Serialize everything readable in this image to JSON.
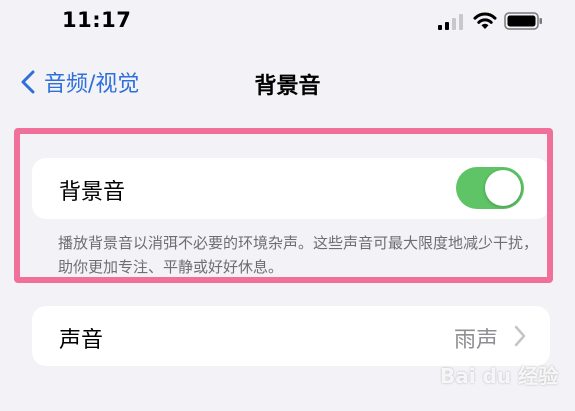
{
  "status_bar": {
    "time": "11:17",
    "signal_icon": "cellular-signal-icon",
    "wifi_icon": "wifi-icon",
    "battery_icon": "battery-icon"
  },
  "nav": {
    "back_label": "音频/视觉",
    "title": "背景音"
  },
  "background_sounds": {
    "label": "背景音",
    "enabled": true,
    "footnote": "播放背景音以消弭不必要的环境杂声。这些声音可最大限度地减少干扰，助你更加专注、平静或好好休息。"
  },
  "sound": {
    "label": "声音",
    "value": "雨声"
  },
  "watermark": "Bai du 经验",
  "colors": {
    "accent": "#2f6fda",
    "toggle_on": "#5ec465",
    "highlight": "#f0709a",
    "background": "#f2f2f7"
  }
}
